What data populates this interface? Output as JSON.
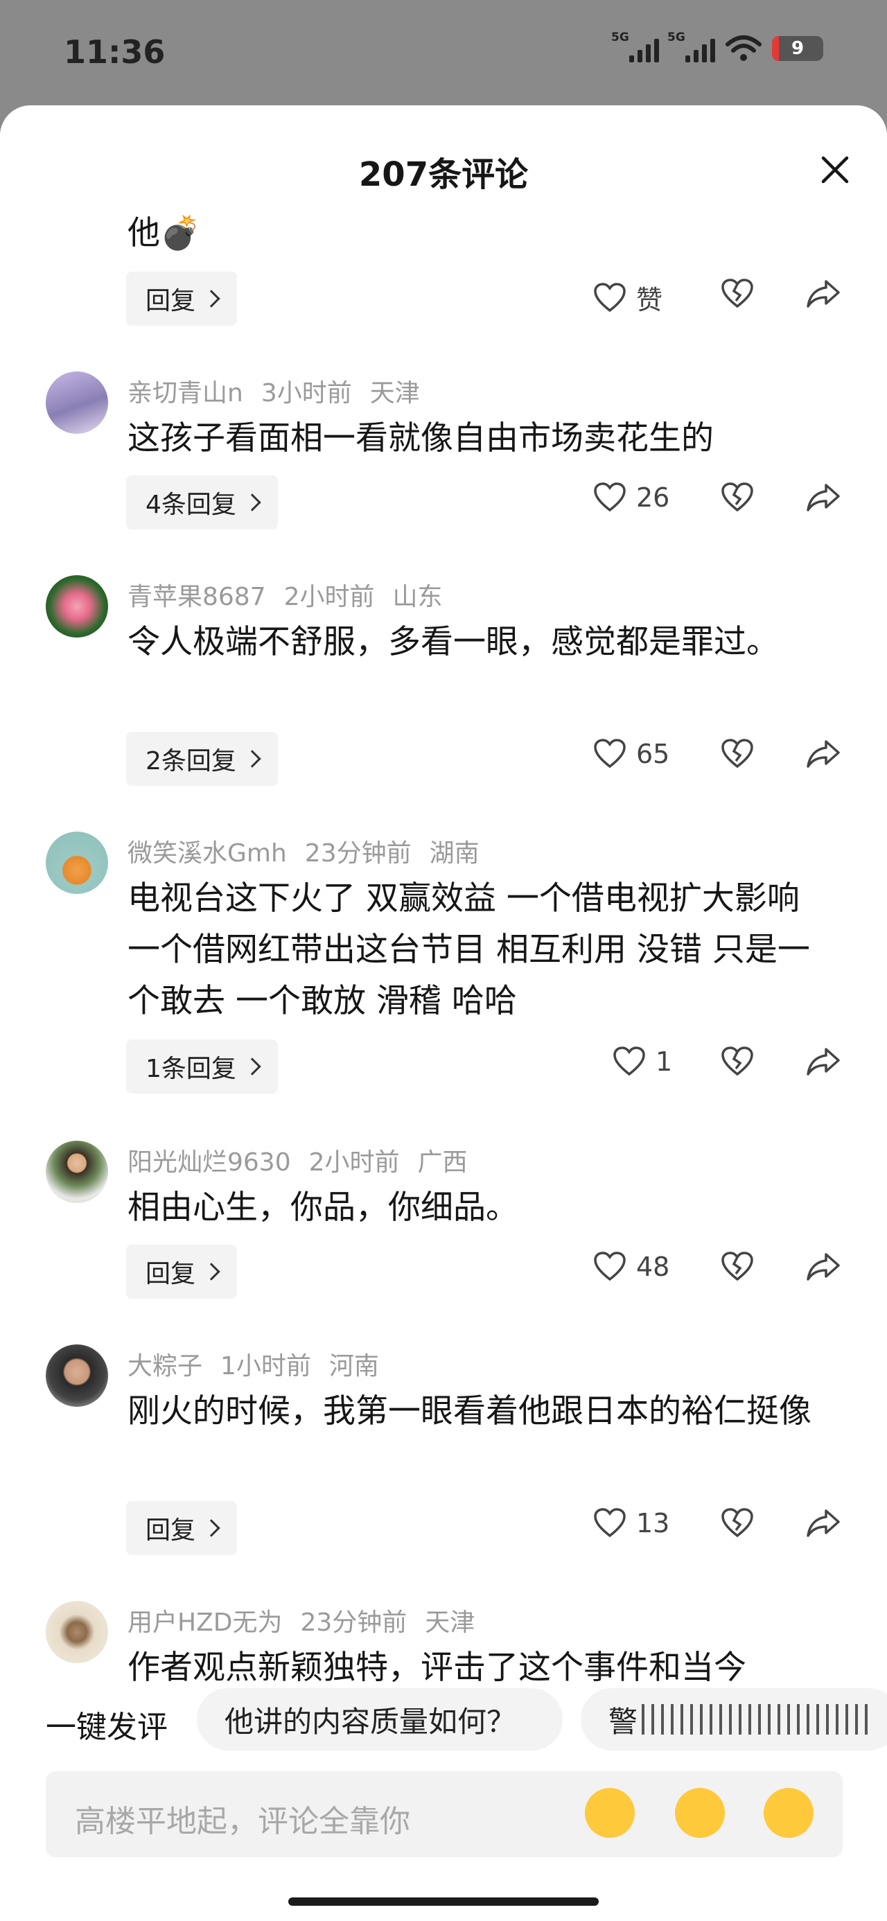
{
  "status": {
    "time": "11:36",
    "network1": "5G",
    "network2": "5G",
    "battery": "9"
  },
  "sheet": {
    "title": "207条评论"
  },
  "comments": [
    {
      "text": "他💣",
      "reply": "回复",
      "likes": "赞"
    },
    {
      "user": "亲切青山n",
      "time": "3小时前",
      "location": "天津",
      "text": "这孩子看面相一看就像自由市场卖花生的",
      "reply": "4条回复",
      "likes": "26"
    },
    {
      "user": "青苹果8687",
      "time": "2小时前",
      "location": "山东",
      "text": "令人极端不舒服，多看一眼，感觉都是罪过。",
      "reply": "2条回复",
      "likes": "65"
    },
    {
      "user": "微笑溪水Gmh",
      "time": "23分钟前",
      "location": "湖南",
      "text": "电视台这下火了 双赢效益 一个借电视扩大影响 一个借网红带出这台节目 相互利用 没错 只是一个敢去 一个敢放 滑稽 哈哈",
      "reply": "1条回复",
      "likes": "1"
    },
    {
      "user": "阳光灿烂9630",
      "time": "2小时前",
      "location": "广西",
      "text": "相由心生，你品，你细品。",
      "reply": "回复",
      "likes": "48"
    },
    {
      "user": "大粽子",
      "time": "1小时前",
      "location": "河南",
      "text": "刚火的时候，我第一眼看着他跟日本的裕仁挺像",
      "reply": "回复",
      "likes": "13"
    },
    {
      "user": "用户HZD无为",
      "time": "23分钟前",
      "location": "天津",
      "text": "作者观点新颖独特，评击了这个事件和当今"
    }
  ],
  "quick": {
    "label": "一键发评",
    "chip1": "他讲的内容质量如何？",
    "chip2": "警"
  },
  "input": {
    "placeholder": "高楼平地起，评论全靠你"
  },
  "colors": {
    "sheet_bg": "#ffffff",
    "overlay": "#8a8a8a",
    "meta": "#9a9a9a",
    "chip_bg": "#f3f3f3"
  },
  "icons": [
    "close-icon",
    "heart-icon",
    "broken-heart-icon",
    "share-icon",
    "emoji-icon"
  ]
}
